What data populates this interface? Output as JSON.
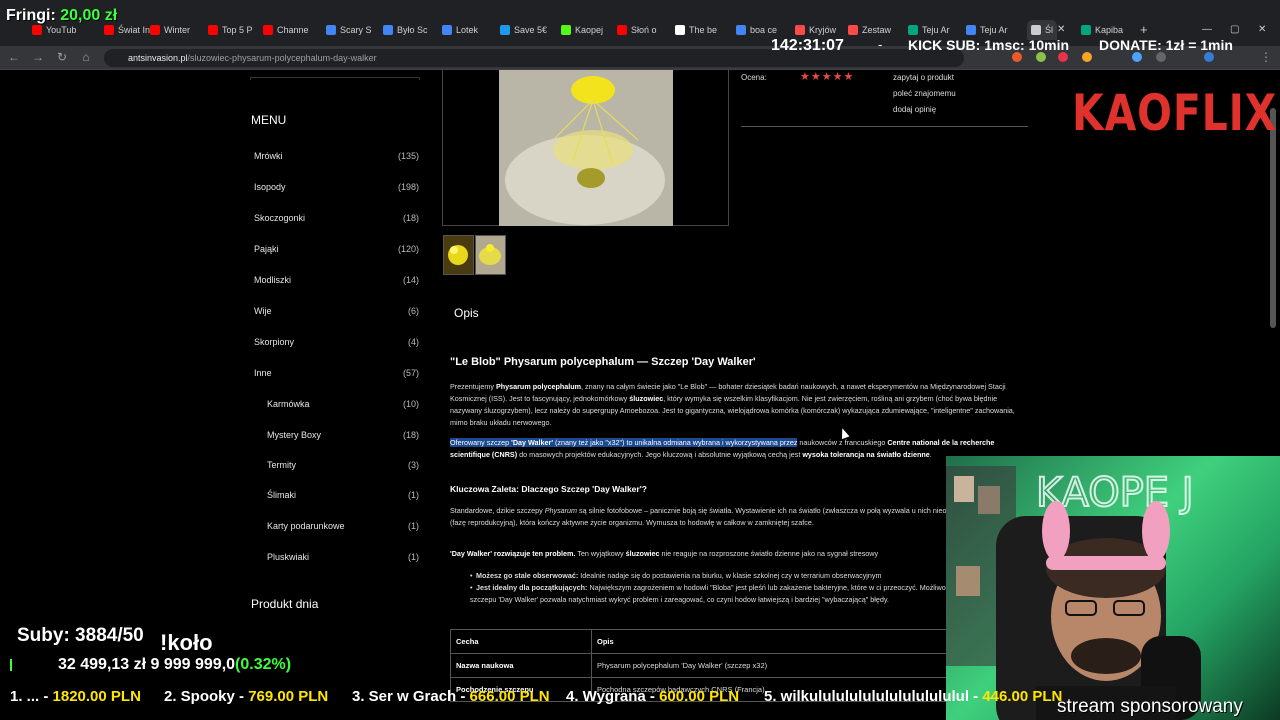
{
  "overlay": {
    "fringi_label": "Fringi:",
    "fringi_amount": "20,00 zł",
    "timer": "142:31:07",
    "dash": "-",
    "kick_sub": "KICK SUB: 1msc: 10min",
    "donate": "DONATE: 1zł = 1min",
    "subs": "Suby: 3884/50",
    "kolo": "!koło",
    "goal_text": "32 499,13 zł 9 999 999,0",
    "goal_pct": "(0.32%)",
    "ticker": [
      {
        "rank": "1. ... - ",
        "amount": "1820.00 PLN"
      },
      {
        "rank": "2. Spooky - ",
        "amount": "769.00 PLN"
      },
      {
        "rank": "3. Ser w Grach - ",
        "amount": "666.00 PLN"
      },
      {
        "rank": "4. Wygrana - ",
        "amount": "600.00 PLN"
      },
      {
        "rank": "5. wilkulululululululululululul - ",
        "amount": "446.00 PLN"
      }
    ],
    "sponsor": "stream sponsorowany",
    "kaoflix": "KAOFLIX",
    "webcam_sign": "KAOPE J"
  },
  "browser": {
    "tabs": [
      {
        "label": "YouTub",
        "color": "#ff0000"
      },
      {
        "label": "Świat In",
        "color": "#ff0000"
      },
      {
        "label": "Winter",
        "color": "#ff0000"
      },
      {
        "label": "Top 5 P",
        "color": "#ff0000"
      },
      {
        "label": "Channe",
        "color": "#ff0000"
      },
      {
        "label": "Scary S",
        "color": "#4285f4"
      },
      {
        "label": "Było Sc",
        "color": "#4285f4"
      },
      {
        "label": "Lotek",
        "color": "#4285f4"
      },
      {
        "label": "Save 5€",
        "color": "#1b9aee"
      },
      {
        "label": "Kaopej",
        "color": "#53fc18"
      },
      {
        "label": "Słoń o",
        "color": "#ff0000"
      },
      {
        "label": "The be",
        "color": "#ffffff"
      },
      {
        "label": "boa ce",
        "color": "#4285f4"
      },
      {
        "label": "Kryjów",
        "color": "#ff4a4a"
      },
      {
        "label": "Zestaw",
        "color": "#ff4a4a"
      },
      {
        "label": "Teju Ar",
        "color": "#00a67e"
      },
      {
        "label": "Teju Ar",
        "color": "#4285f4"
      },
      {
        "label": "Śl",
        "color": "#cccccc"
      },
      {
        "label": "Kapiba",
        "color": "#00a67e"
      }
    ],
    "url_domain": "antsinvasion.pl",
    "url_path": "/sluzowiec-physarum-polycephalum-day-walker"
  },
  "sidebar": {
    "menu_title": "MENU",
    "items": [
      {
        "label": "Mrówki",
        "count": "(135)"
      },
      {
        "label": "Isopody",
        "count": "(198)"
      },
      {
        "label": "Skoczogonki",
        "count": "(18)"
      },
      {
        "label": "Pająki",
        "count": "(120)"
      },
      {
        "label": "Modliszki",
        "count": "(14)"
      },
      {
        "label": "Wije",
        "count": "(6)"
      },
      {
        "label": "Skorpiony",
        "count": "(4)"
      },
      {
        "label": "Inne",
        "count": "(57)"
      },
      {
        "label": "Karmówka",
        "count": "(10)"
      },
      {
        "label": "Mystery Boxy",
        "count": "(18)"
      },
      {
        "label": "Termity",
        "count": "(3)"
      },
      {
        "label": "Ślimaki",
        "count": "(1)"
      },
      {
        "label": "Karty podarunkowe",
        "count": "(1)"
      },
      {
        "label": "Pluskwiaki",
        "count": "(1)"
      }
    ],
    "produkt_dnia": "Produkt dnia"
  },
  "product": {
    "rating_label": "Ocena:",
    "stars": "★★★★★",
    "links": [
      "zapytaj o produkt",
      "poleć znajomemu",
      "dodaj opinię"
    ],
    "opis": "Opis",
    "title": "\"Le Blob\" Physarum polycephalum — Szczep 'Day Walker'",
    "p1_a": "Prezentujemy ",
    "p1_b": "Physarum polycephalum",
    "p1_c": ", znany na całym świecie jako \"Le Blob\" — bohater dziesiątek badań naukowych, a nawet eksperymentów na Międzynarodowej Stacji Kosmicznej (ISS). Jest to fascynujący, jednokomórkowy ",
    "p1_d": "śluzowiec",
    "p1_e": ", który wymyka się wszelkim klasyfikacjom. Nie jest zwierzęciem, rośliną ani grzybem (choć bywa błędnie nazywany śluzogrzybem), lecz należy do supergrupy Amoebozoa. Jest to gigantyczna, wielojądrowa komórka (komórczak) wykazująca zdumiewające, \"inteligentne\" zachowania, mimo braku układu nerwowego.",
    "p2_hl_a": "Oferowany szczep ",
    "p2_hl_b": "'Day Walker'",
    "p2_hl_c": " (znany też jako \"x32\") to unikalna odmiana wybrana i wykorzystywana przez",
    "p2_a": " naukowców z francuskiego ",
    "p2_b": "Centre national de la recherche scientifique (CNRS)",
    "p2_c": " do masowych projektów edukacyjnych. Jego kluczową i absolutnie wyjątkową cechą jest ",
    "p2_d": "wysoka tolerancja na światło dzienne",
    "p2_e": ".",
    "h2": "Kluczowa Zaleta: Dlaczego Szczep 'Day Walker'?",
    "p3_a": "Standardowe, dzikie szczepy ",
    "p3_b": "Physarum",
    "p3_c": " są silnie fotofobowe – panicznie boją się światła. Wystawienie ich na światło (zwłaszcza w połą wyzwala u nich nieodwracalną sporulację (fazę reprodukcyjną), która kończy aktywne życie organizmu. Wymusza to hodowlę w całkow w zamkniętej szafce.",
    "p4_a": "'Day Walker' rozwiązuje ten problem.",
    "p4_b": " Ten wyjątkowy ",
    "p4_c": "śluzowiec",
    "p4_d": " nie reaguje na rozproszone światło dzienne jako na sygnał stresowy",
    "b1_a": "Możesz go stale obserwować:",
    "b1_b": " Idealnie nadaje się do postawienia na biurku, w klasie szkolnej czy w terrarium obserwacyjnym",
    "b2_a": "Jest idealny dla początkujących:",
    "b2_b": " Największym zagrożeniem w hodowli \"Bloba\" jest pleśń lub zakażenie bakteryjne, które w ci przeoczyć. Możliwość stałej obserwacji szczepu 'Day Walker' pozwala natychmiast wykryć problem i zareagować, co czyni hodow łatwiejszą i bardziej \"wybaczającą\" błędy.",
    "table": {
      "headers": [
        "Cecha",
        "Opis"
      ],
      "rows": [
        [
          "Nazwa naukowa",
          "Physarum polycephalum 'Day Walker' (szczep x32)"
        ],
        [
          "Pochodzenie szczepu",
          "Pochodna szczepów badawczych CNRS (Francja)"
        ]
      ]
    }
  }
}
